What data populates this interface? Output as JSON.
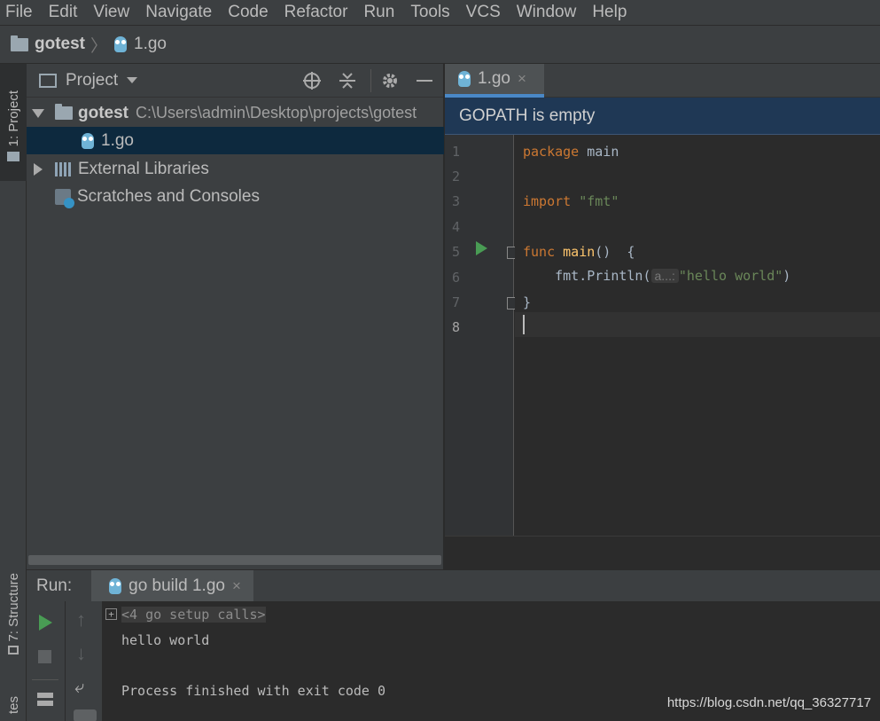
{
  "menu": [
    "File",
    "Edit",
    "View",
    "Navigate",
    "Code",
    "Refactor",
    "Run",
    "Tools",
    "VCS",
    "Window",
    "Help"
  ],
  "breadcrumb": {
    "project": "gotest",
    "file": "1.go"
  },
  "left_strip": {
    "project_tab": "1: Project",
    "structure_tab": "7: Structure",
    "favorites_tab": "tes"
  },
  "project_panel": {
    "title": "Project",
    "tree": {
      "root_name": "gotest",
      "root_path": "C:\\Users\\admin\\Desktop\\projects\\gotest",
      "file": "1.go",
      "external": "External Libraries",
      "scratches": "Scratches and Consoles"
    }
  },
  "editor": {
    "tab_label": "1.go",
    "banner": "GOPATH is empty",
    "line_numbers": [
      "1",
      "2",
      "3",
      "4",
      "5",
      "6",
      "7",
      "8"
    ],
    "code": {
      "l1_kw": "package",
      "l1_rest": " main",
      "l3_kw": "import",
      "l3_str": " \"fmt\"",
      "l5_kw": "func",
      "l5_fn": " main",
      "l5_rest": "()  {",
      "l6_call": "    fmt.Println(",
      "l6_hint": "a...:",
      "l6_str": "\"hello world\"",
      "l6_end": ")",
      "l7": "}"
    }
  },
  "run": {
    "label": "Run:",
    "tab": "go build 1.go",
    "console": {
      "setup": "<4 go setup calls>",
      "output": "hello world",
      "exit": "Process finished with exit code 0"
    }
  },
  "watermark": "https://blog.csdn.net/qq_36327717",
  "colors": {
    "keyword": "#cc7832",
    "function": "#ffc66d",
    "string": "#6a8759",
    "banner": "#1f3855",
    "selection": "#0d293e",
    "run_green": "#499c54"
  }
}
